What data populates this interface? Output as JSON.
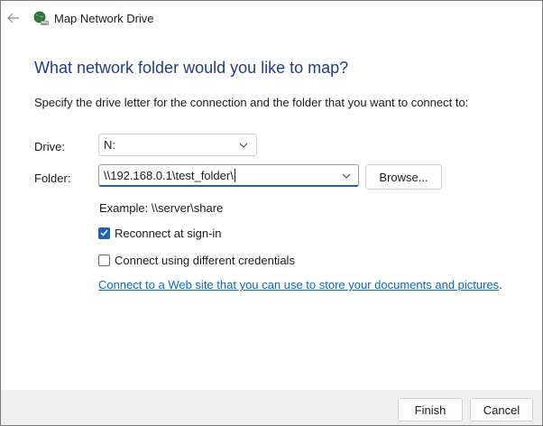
{
  "window": {
    "title": "Map Network Drive"
  },
  "icons": {
    "back": "back-arrow-icon",
    "app": "network-drive-icon",
    "dropdown": "chevron-down-icon",
    "check": "checkmark-icon"
  },
  "page": {
    "heading": "What network folder would you like to map?",
    "instruction": "Specify the drive letter for the connection and the folder that you want to connect to:"
  },
  "form": {
    "drive_label": "Drive:",
    "drive_value": "N:",
    "folder_label": "Folder:",
    "folder_value": "\\\\192.168.0.1\\test_folder\\",
    "browse_label": "Browse...",
    "example": "Example: \\\\server\\share",
    "reconnect": {
      "label": "Reconnect at sign-in",
      "checked": true
    },
    "credentials": {
      "label": "Connect using different credentials",
      "checked": false
    },
    "web_link": "Connect to a Web site that you can use to store your documents and pictures",
    "web_link_suffix": "."
  },
  "footer": {
    "finish_label": "Finish",
    "cancel_label": "Cancel"
  },
  "colors": {
    "heading": "#1f3c8f",
    "accent": "#1f5fbf",
    "link": "#0a67c2",
    "footer_bg": "#f0f0f0"
  }
}
